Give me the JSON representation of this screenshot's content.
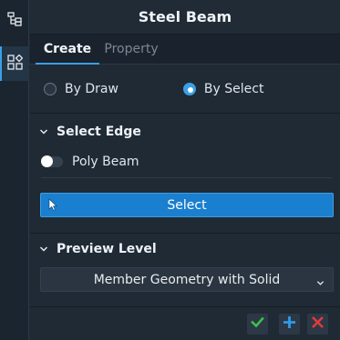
{
  "rail": {
    "items": [
      {
        "icon": "tree-outline-icon",
        "active": false
      },
      {
        "icon": "grid-diamond-icon",
        "active": true
      }
    ]
  },
  "title": "Steel Beam",
  "tabs": [
    {
      "label": "Create",
      "active": true
    },
    {
      "label": "Property",
      "active": false
    }
  ],
  "mode": {
    "options": [
      {
        "label": "By Draw",
        "selected": false
      },
      {
        "label": "By Select",
        "selected": true
      }
    ]
  },
  "select_edge": {
    "header": "Select Edge",
    "poly_beam_label": "Poly Beam",
    "poly_beam_on": false,
    "select_button": "Select"
  },
  "preview_level": {
    "header": "Preview Level",
    "selected": "Member Geometry with Solid"
  },
  "footer": {
    "ok_icon": "check-icon",
    "add_icon": "plus-icon",
    "cancel_icon": "close-icon"
  },
  "colors": {
    "accent": "#3aa0e6",
    "button": "#1a7fcf",
    "ok": "#3cc04a",
    "add": "#2f9ae8",
    "cancel": "#e2393b"
  }
}
